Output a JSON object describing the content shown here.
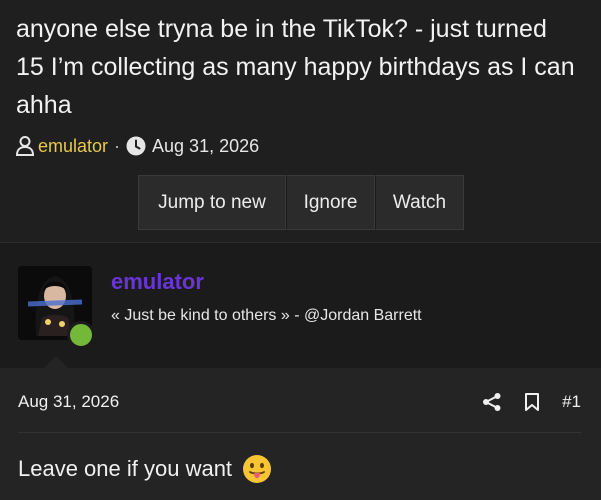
{
  "thread": {
    "title": "anyone else tryna be in the TikTok? - just turned 15 I’m collecting as many happy birthdays as I can ahha",
    "author": "emulator",
    "separator": "·",
    "date": "Aug 31, 2026"
  },
  "buttons": {
    "jump_label": "Jump to new",
    "ignore_label": "Ignore",
    "watch_label": "Watch"
  },
  "user": {
    "name": "emulator",
    "signature": "« Just be kind to others » - @Jordan Barrett",
    "name_color": "#6a35d8",
    "online_color": "#74b83a"
  },
  "post": {
    "date": "Aug 31, 2026",
    "number": "#1",
    "body": "Leave one if you want",
    "emoji": "face-with-tongue-icon"
  },
  "icons": [
    "user-icon",
    "clock-icon",
    "share-icon",
    "bookmark-icon"
  ]
}
